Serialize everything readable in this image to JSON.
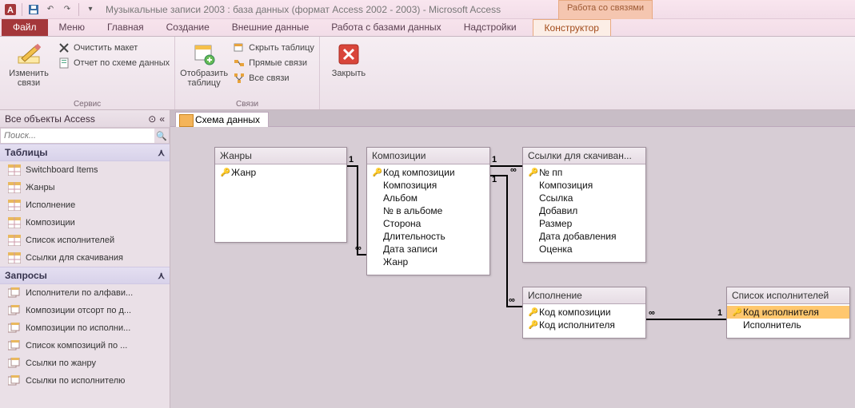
{
  "title": "Музыкальные записи 2003 : база данных (формат Access 2002 - 2003)  -  Microsoft Access",
  "context_tab_group": "Работа со связями",
  "ribbon_tabs": {
    "file": "Файл",
    "menu": "Меню",
    "home": "Главная",
    "create": "Создание",
    "external": "Внешние данные",
    "dbtools": "Работа с базами данных",
    "addins": "Надстройки",
    "designer": "Конструктор"
  },
  "ribbon": {
    "group_service": "Сервис",
    "group_relations": "Связи",
    "edit_relations": "Изменить связи",
    "clear_layout": "Очистить макет",
    "schema_report": "Отчет по схеме данных",
    "show_table": "Отобразить таблицу",
    "hide_table": "Скрыть таблицу",
    "direct_relations": "Прямые связи",
    "all_relations": "Все связи",
    "close": "Закрыть"
  },
  "nav": {
    "header": "Все объекты Access",
    "search_placeholder": "Поиск...",
    "group_tables": "Таблицы",
    "group_queries": "Запросы",
    "tables": [
      "Switchboard Items",
      "Жанры",
      "Исполнение",
      "Композиции",
      "Список исполнителей",
      "Ссылки для скачивания"
    ],
    "queries": [
      "Исполнители по алфави...",
      "Композиции отсорт по д...",
      "Композиции по исполни...",
      "Список композиций  по ...",
      "Ссылки по жанру",
      "Ссылки по исполнителю"
    ]
  },
  "doc_tab": "Схема данных",
  "schema": {
    "tables": {
      "t1": {
        "title": "Жанры",
        "fields": [
          {
            "k": true,
            "n": "Жанр"
          }
        ]
      },
      "t2": {
        "title": "Композиции",
        "fields": [
          {
            "k": true,
            "n": "Код композиции"
          },
          {
            "k": false,
            "n": "Композиция"
          },
          {
            "k": false,
            "n": "Альбом"
          },
          {
            "k": false,
            "n": "№ в альбоме"
          },
          {
            "k": false,
            "n": "Сторона"
          },
          {
            "k": false,
            "n": "Длительность"
          },
          {
            "k": false,
            "n": "Дата записи"
          },
          {
            "k": false,
            "n": "Жанр"
          }
        ]
      },
      "t3": {
        "title": "Ссылки для скачиван...",
        "fields": [
          {
            "k": true,
            "n": "№ пп"
          },
          {
            "k": false,
            "n": "Композиция"
          },
          {
            "k": false,
            "n": "Ссылка"
          },
          {
            "k": false,
            "n": "Добавил"
          },
          {
            "k": false,
            "n": "Размер"
          },
          {
            "k": false,
            "n": "Дата добавления"
          },
          {
            "k": false,
            "n": "Оценка"
          }
        ]
      },
      "t4": {
        "title": "Исполнение",
        "fields": [
          {
            "k": true,
            "n": "Код композиции"
          },
          {
            "k": true,
            "n": "Код исполнителя"
          }
        ]
      },
      "t5": {
        "title": "Список исполнителей",
        "fields": [
          {
            "k": true,
            "n": "Код исполнителя",
            "sel": true
          },
          {
            "k": false,
            "n": "Исполнитель"
          }
        ]
      }
    },
    "cardinality": {
      "one": "1",
      "many": "∞"
    }
  }
}
